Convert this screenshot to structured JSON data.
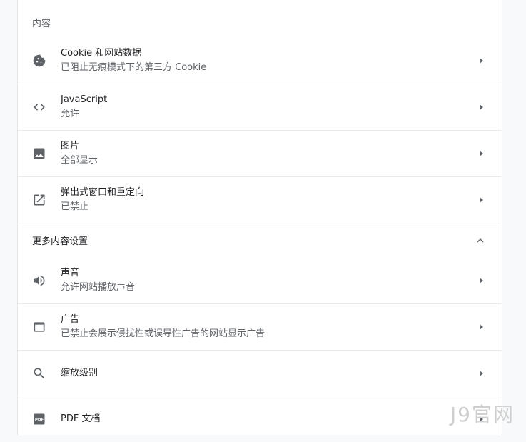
{
  "content_section": {
    "title": "内容"
  },
  "items": [
    {
      "label": "Cookie 和网站数据",
      "sub": "已阻止无痕模式下的第三方 Cookie",
      "icon": "cookie-icon"
    },
    {
      "label": "JavaScript",
      "sub": "允许",
      "icon": "code-icon"
    },
    {
      "label": "图片",
      "sub": "全部显示",
      "icon": "image-icon"
    },
    {
      "label": "弹出式窗口和重定向",
      "sub": "已禁止",
      "icon": "open-in-new-icon"
    }
  ],
  "more_section": {
    "title": "更多内容设置",
    "expanded": true
  },
  "more_items": [
    {
      "label": "声音",
      "sub": "允许网站播放声音",
      "icon": "volume-icon"
    },
    {
      "label": "广告",
      "sub": "已禁止会展示侵扰性或误导性广告的网站显示广告",
      "icon": "ads-icon"
    },
    {
      "label": "缩放级别",
      "sub": "",
      "icon": "zoom-icon"
    },
    {
      "label": "PDF 文档",
      "sub": "",
      "icon": "pdf-icon"
    }
  ],
  "watermark": "J9官网"
}
